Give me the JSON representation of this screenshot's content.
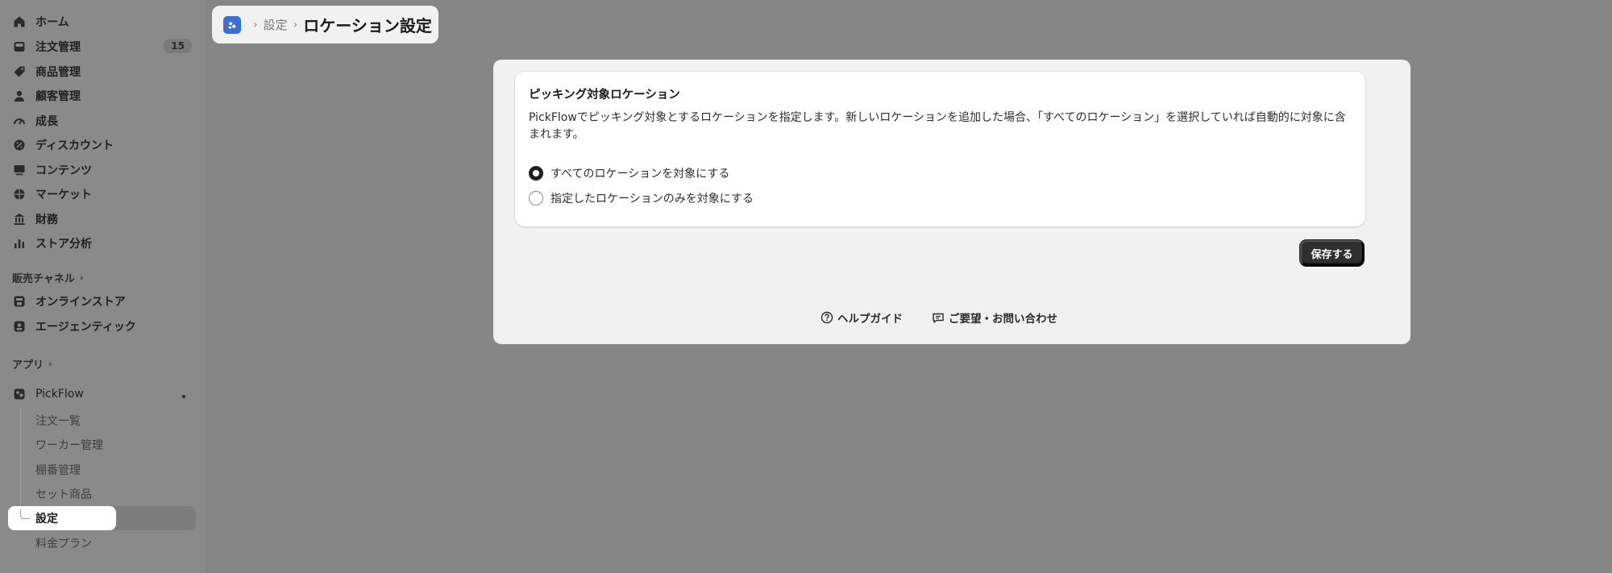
{
  "sidebar": {
    "nav": [
      {
        "label": "ホーム",
        "icon": "home-icon"
      },
      {
        "label": "注文管理",
        "icon": "inbox-icon",
        "badge": "15"
      },
      {
        "label": "商品管理",
        "icon": "tag-icon"
      },
      {
        "label": "顧客管理",
        "icon": "person-icon"
      },
      {
        "label": "成長",
        "icon": "gauge-icon"
      },
      {
        "label": "ディスカウント",
        "icon": "discount-icon"
      },
      {
        "label": "コンテンツ",
        "icon": "content-icon"
      },
      {
        "label": "マーケット",
        "icon": "globe-icon"
      },
      {
        "label": "財務",
        "icon": "bank-icon"
      },
      {
        "label": "ストア分析",
        "icon": "bar-chart-icon"
      }
    ],
    "sales_channels_title": "販売チャネル",
    "channels": [
      {
        "label": "オンラインストア",
        "icon": "store-icon"
      },
      {
        "label": "エージェンティック",
        "icon": "agent-icon"
      }
    ],
    "apps_title": "アプリ",
    "app": {
      "label": "PickFlow",
      "icon": "app-icon"
    },
    "app_items": [
      {
        "label": "注文一覧"
      },
      {
        "label": "ワーカー管理"
      },
      {
        "label": "棚番管理"
      },
      {
        "label": "セット商品"
      },
      {
        "label": "設定",
        "active": true
      },
      {
        "label": "料金プラン"
      }
    ]
  },
  "breadcrumb": {
    "parent": "設定",
    "current": "ロケーション設定"
  },
  "card": {
    "title": "ピッキング対象ロケーション",
    "description": "PickFlowでピッキング対象とするロケーションを指定します。新しいロケーションを追加した場合、「すべてのロケーション」を選択していれば自動的に対象に含まれます。",
    "options": [
      {
        "label": "すべてのロケーションを対象にする",
        "checked": true
      },
      {
        "label": "指定したロケーションのみを対象にする",
        "checked": false
      }
    ]
  },
  "save_label": "保存する",
  "footer": {
    "help_label": "ヘルプガイド",
    "contact_label": "ご要望・お問い合わせ"
  },
  "colors": {
    "overlay_bg": "#868686",
    "panel_bg": "#f1f1f1",
    "primary_button": "#2f2f2f",
    "app_icon": "#3b6fd8"
  }
}
